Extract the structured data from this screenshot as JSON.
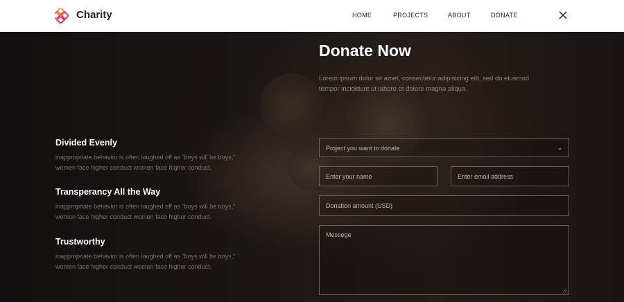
{
  "header": {
    "brand": "Charity",
    "nav": [
      {
        "label": "HOME"
      },
      {
        "label": "PROJECTS"
      },
      {
        "label": "ABOUT"
      },
      {
        "label": "DONATE"
      }
    ],
    "close_icon": "close-icon"
  },
  "donate": {
    "title": "Donate Now",
    "lead": "Lorem ipsum dolor sit amet, consectetur adipisicing elit, sed do eiusmod tempor incididunt ut labore et dolore magna aliqua."
  },
  "features": [
    {
      "title": "Divided Evenly",
      "text": "inappropriate behavior is often laughed off as \"boys will be boys,\" women face higher conduct women face higher conduct."
    },
    {
      "title": "Transperancy All the Way",
      "text": "inappropriate behavior is often laughed off as \"boys will be boys,\" women face higher conduct women face higher conduct."
    },
    {
      "title": "Trustworthy",
      "text": "inappropriate behavior is often laughed off as \"boys will be boys,\" women face higher conduct women face higher conduct."
    }
  ],
  "form": {
    "project_select": "Project you want to donate",
    "name_placeholder": "Enter your name",
    "email_placeholder": "Enter email address",
    "amount_placeholder": "Donation amount (USD)",
    "message_placeholder": "Messege"
  },
  "colors": {
    "header_bg": "#ffffff",
    "hero_bg": "#1a1614",
    "text_muted": "#77706a"
  }
}
